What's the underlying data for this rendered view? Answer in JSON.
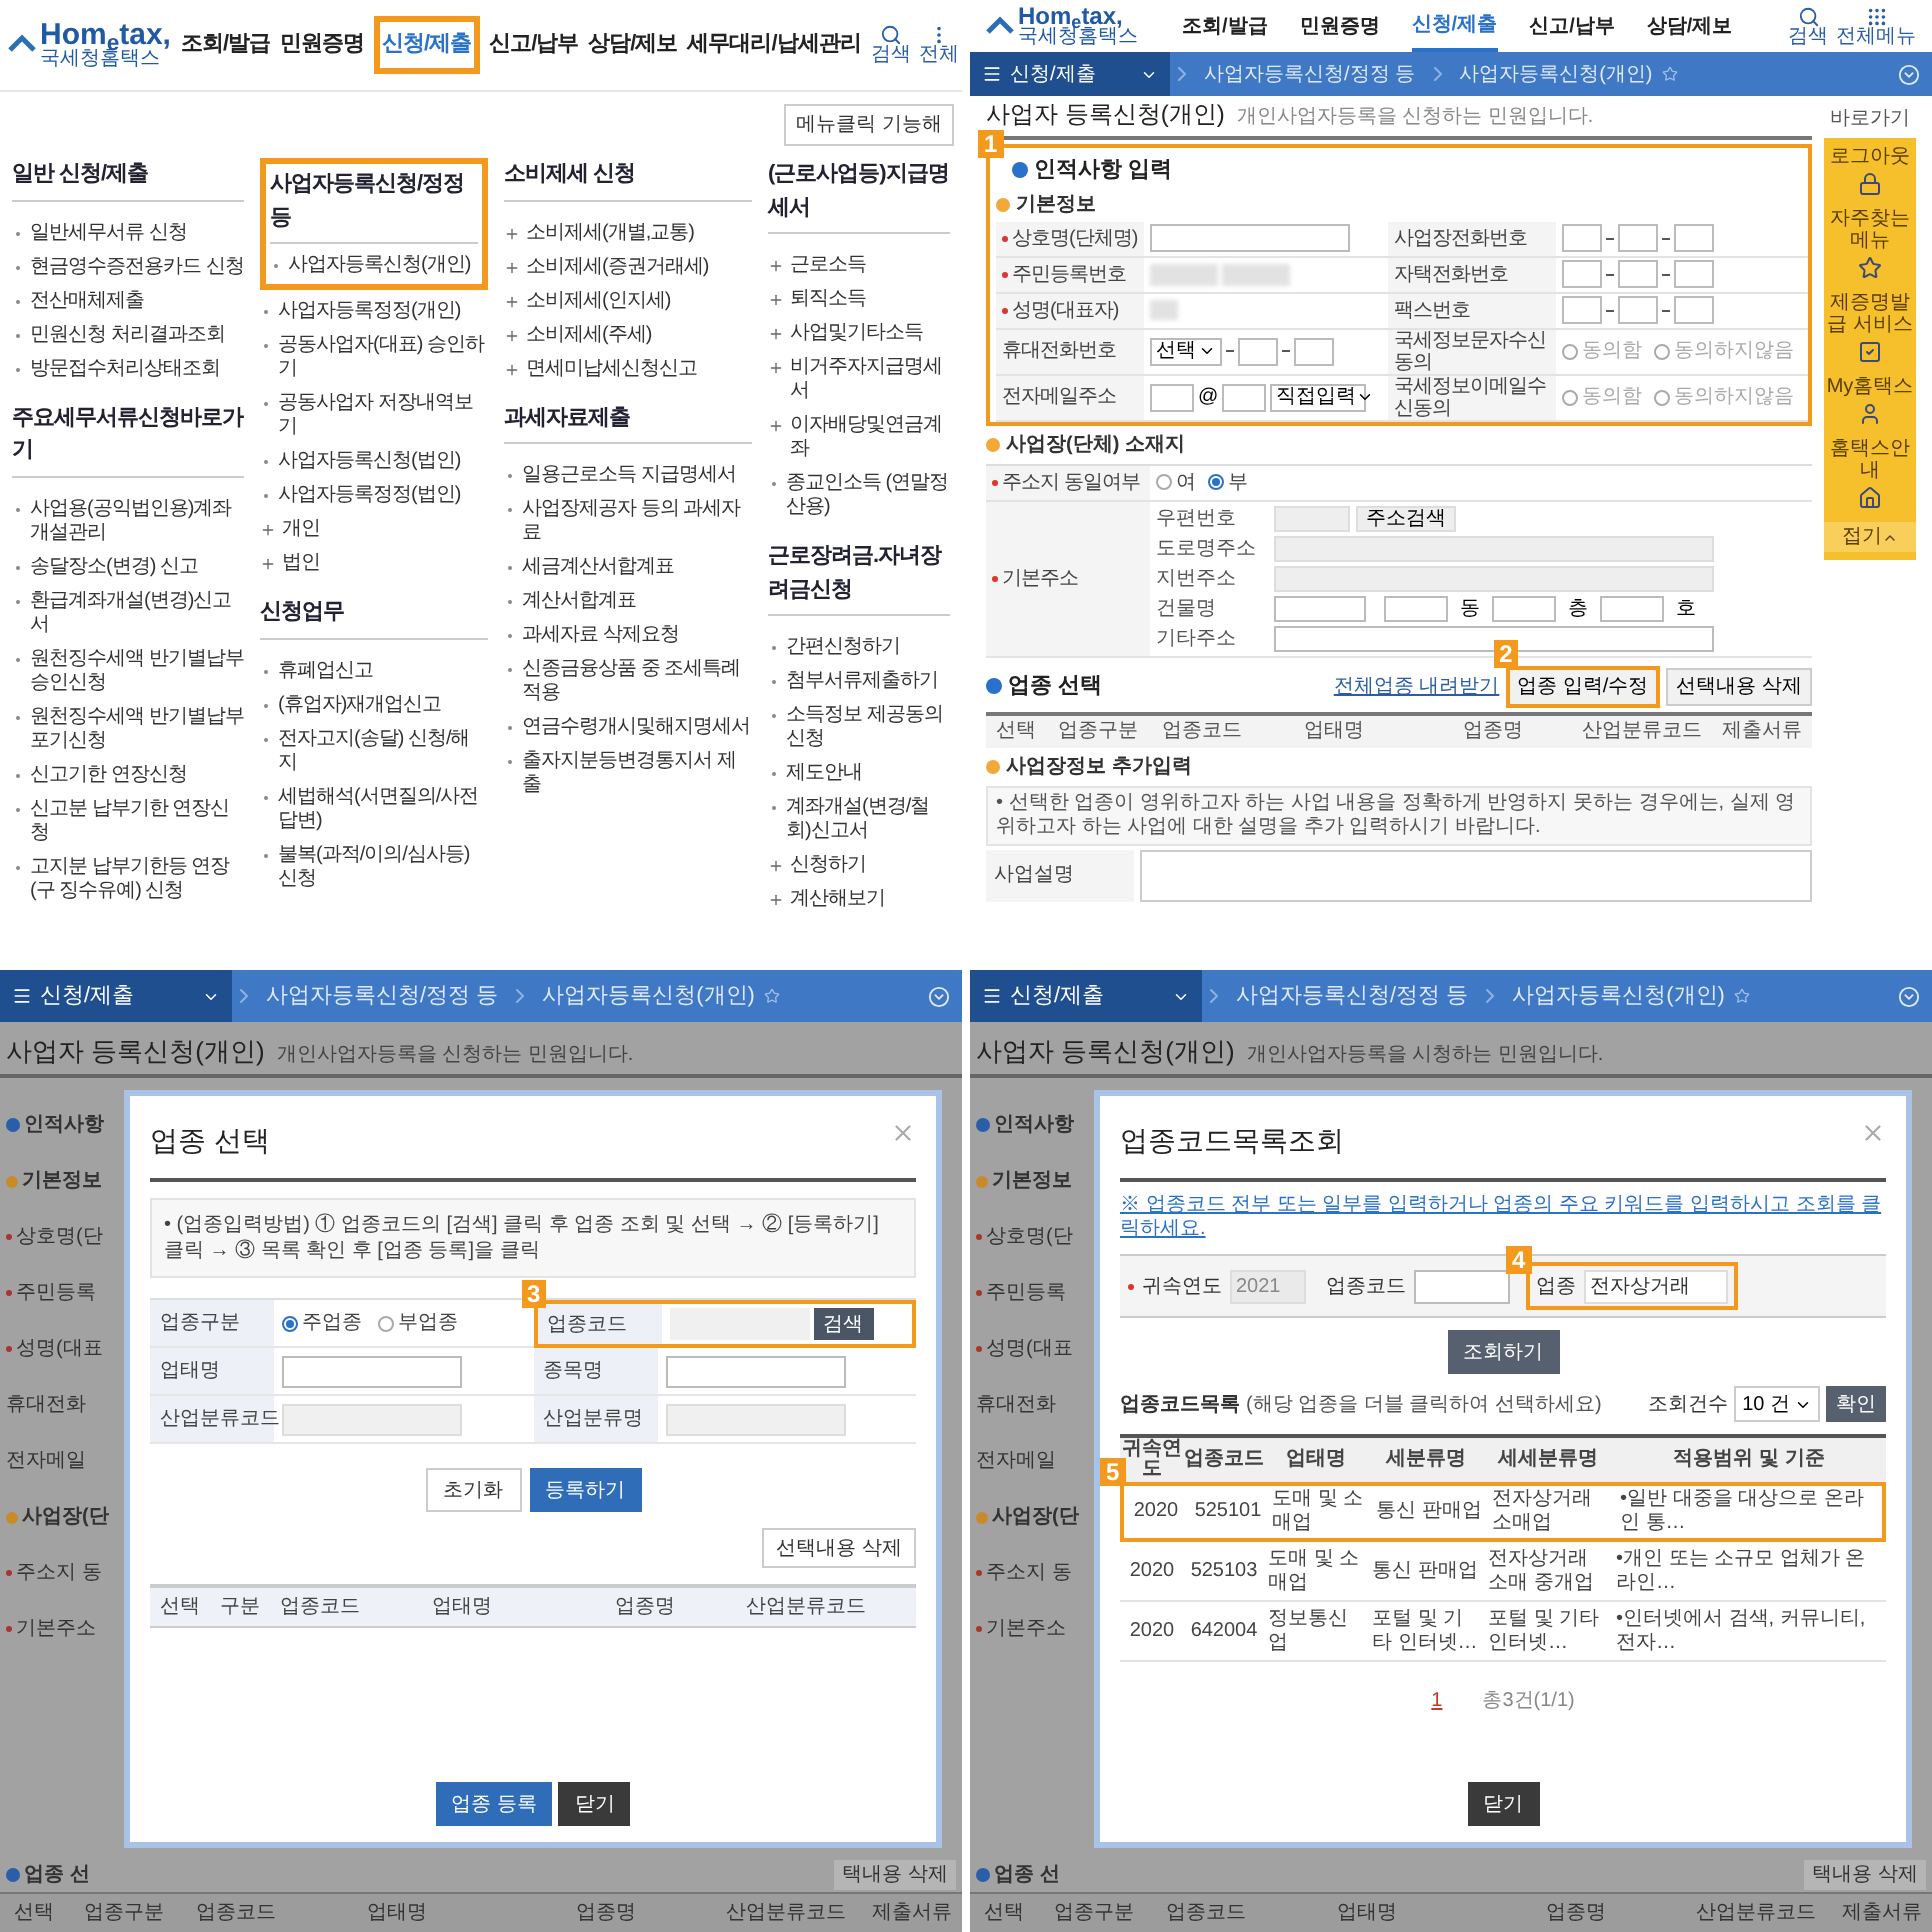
{
  "menu_screen": {
    "logo": {
      "name": "Hom$_{e}$tax,",
      "subtitle": "국세청홈택스"
    },
    "nav": [
      {
        "label": "조회/발급",
        "selected": false
      },
      {
        "label": "민원증명",
        "selected": false
      },
      {
        "label": "신청/제출",
        "selected": true
      },
      {
        "label": "신고/납부",
        "selected": false
      },
      {
        "label": "상담/제보",
        "selected": false
      },
      {
        "label": "세무대리/납세관리",
        "selected": false
      }
    ],
    "utilities": [
      {
        "kind": "search",
        "label": "검색"
      },
      {
        "kind": "more",
        "label": "전체"
      }
    ],
    "menu_toggle": "메뉴클릭 기능해",
    "columns": [
      [
        {
          "heading": "일반 신청/제출",
          "highlighted": false,
          "items": [
            {
              "label": "일반세무서류 신청",
              "kind": "bullet"
            },
            {
              "label": "현금영수증전용카드 신청",
              "kind": "bullet"
            },
            {
              "label": "전산매체제출",
              "kind": "bullet"
            },
            {
              "label": "민원신청 처리결과조회",
              "kind": "bullet"
            },
            {
              "label": "방문접수처리상태조회",
              "kind": "bullet"
            }
          ]
        },
        {
          "heading": "주요세무서류신청바로가기",
          "highlighted": false,
          "items": [
            {
              "label": "사업용(공익법인용)계좌 개설관리",
              "kind": "bullet"
            },
            {
              "label": "송달장소(변경) 신고",
              "kind": "bullet"
            },
            {
              "label": "환급계좌개설(변경)신고서",
              "kind": "bullet"
            },
            {
              "label": "원천징수세액 반기별납부 승인신청",
              "kind": "bullet"
            },
            {
              "label": "원천징수세액 반기별납부 포기신청",
              "kind": "bullet"
            },
            {
              "label": "신고기한 연장신청",
              "kind": "bullet"
            },
            {
              "label": "신고분 납부기한 연장신청",
              "kind": "bullet"
            },
            {
              "label": "고지분 납부기한등 연장(구 징수유예) 신청",
              "kind": "bullet"
            }
          ]
        }
      ],
      [
        {
          "heading": "사업자등록신청/정정 등",
          "highlighted": true,
          "items": [
            {
              "label": "사업자등록신청(개인)",
              "kind": "bullet"
            },
            {
              "label": "사업자등록정정(개인)",
              "kind": "bullet"
            },
            {
              "label": "공동사업자(대표) 승인하기",
              "kind": "bullet"
            },
            {
              "label": "공동사업자 저장내역보기",
              "kind": "bullet"
            },
            {
              "label": "사업자등록신청(법인)",
              "kind": "bullet"
            },
            {
              "label": "사업자등록정정(법인)",
              "kind": "bullet"
            },
            {
              "label": "개인",
              "kind": "plus"
            },
            {
              "label": "법인",
              "kind": "plus"
            }
          ]
        },
        {
          "heading": "신청업무",
          "highlighted": false,
          "items": [
            {
              "label": "휴폐업신고",
              "kind": "bullet"
            },
            {
              "label": "(휴업자)재개업신고",
              "kind": "bullet"
            },
            {
              "label": "전자고지(송달) 신청/해지",
              "kind": "bullet"
            },
            {
              "label": "세법해석(서면질의/사전답변)",
              "kind": "bullet"
            },
            {
              "label": "불복(과적/이의/심사등)신청",
              "kind": "bullet"
            }
          ]
        }
      ],
      [
        {
          "heading": "소비제세 신청",
          "highlighted": false,
          "items": [
            {
              "label": "소비제세(개별,교통)",
              "kind": "plus"
            },
            {
              "label": "소비제세(증권거래세)",
              "kind": "plus"
            },
            {
              "label": "소비제세(인지세)",
              "kind": "plus"
            },
            {
              "label": "소비제세(주세)",
              "kind": "plus"
            },
            {
              "label": "면세미납세신청신고",
              "kind": "plus"
            }
          ]
        },
        {
          "heading": "과세자료제출",
          "highlighted": false,
          "items": [
            {
              "label": "일용근로소득 지급명세서",
              "kind": "bullet"
            },
            {
              "label": "사업장제공자 등의 과세자료",
              "kind": "bullet"
            },
            {
              "label": "세금계산서합계표",
              "kind": "bullet"
            },
            {
              "label": "계산서합계표",
              "kind": "bullet"
            },
            {
              "label": "과세자료 삭제요청",
              "kind": "bullet"
            },
            {
              "label": "신종금융상품 중 조세특례적용",
              "kind": "bullet"
            },
            {
              "label": "연금수령개시및해지명세서",
              "kind": "bullet"
            },
            {
              "label": "출자지분등변경통지서 제출",
              "kind": "bullet"
            }
          ]
        }
      ],
      [
        {
          "heading": "(근로사업등)지급명세서",
          "highlighted": false,
          "items": [
            {
              "label": "근로소득",
              "kind": "plus"
            },
            {
              "label": "퇴직소득",
              "kind": "plus"
            },
            {
              "label": "사업및기타소득",
              "kind": "plus"
            },
            {
              "label": "비거주자지급명세서",
              "kind": "plus"
            },
            {
              "label": "이자배당및연금계좌",
              "kind": "plus"
            },
            {
              "label": "종교인소득 (연말정산용)",
              "kind": "bullet"
            }
          ]
        },
        {
          "heading": "근로장려금.자녀장려금신청",
          "highlighted": false,
          "items": [
            {
              "label": "간편신청하기",
              "kind": "bullet"
            },
            {
              "label": "첨부서류제출하기",
              "kind": "bullet"
            },
            {
              "label": "소득정보 제공동의 신청",
              "kind": "bullet"
            },
            {
              "label": "제도안내",
              "kind": "bullet"
            },
            {
              "label": "계좌개설(변경/철회)신고서",
              "kind": "bullet"
            },
            {
              "label": "신청하기",
              "kind": "plus"
            },
            {
              "label": "계산해보기",
              "kind": "plus"
            }
          ]
        }
      ]
    ]
  },
  "form_screen": {
    "logo": {
      "name": "Hom$_{e}$tax,",
      "subtitle": "국세청홈택스"
    },
    "nav": [
      {
        "label": "조회/발급",
        "selected": false
      },
      {
        "label": "민원증명",
        "selected": false
      },
      {
        "label": "신청/제출",
        "selected": true
      },
      {
        "label": "신고/납부",
        "selected": false
      },
      {
        "label": "상담/제보",
        "selected": false
      }
    ],
    "utilities": [
      {
        "kind": "search",
        "label": "검색"
      },
      {
        "kind": "grid",
        "label": "전체메뉴"
      }
    ],
    "breadcrumb": {
      "menu": "신청/제출",
      "items": [
        "사업자등록신청/정정 등",
        "사업자등록신청(개인)"
      ]
    },
    "page_title": "사업자 등록신청(개인)",
    "page_description": "개인사업자등록을 신청하는 민원입니다.",
    "personal": {
      "step": "1",
      "heading": "인적사항 입력",
      "subheading": "기본정보",
      "rows": [
        {
          "left": {
            "label": "상호명(단체명)",
            "required": true,
            "kind": "text"
          },
          "right": {
            "label": "사업장전화번호",
            "kind": "phone"
          }
        },
        {
          "left": {
            "label": "주민등록번호",
            "required": true,
            "kind": "masked"
          },
          "right": {
            "label": "자택전화번호",
            "kind": "phone"
          }
        },
        {
          "left": {
            "label": "성명(대표자)",
            "required": true,
            "kind": "masked_short"
          },
          "right": {
            "label": "팩스번호",
            "kind": "phone"
          }
        },
        {
          "left": {
            "label": "휴대전화번호",
            "required": false,
            "kind": "phone_select",
            "select": "선택"
          },
          "right": {
            "label": "국세정보문자수신동의",
            "kind": "radio",
            "options": [
              {
                "label": "동의함",
                "selected": false
              },
              {
                "label": "동의하지않음",
                "selected": false
              }
            ]
          }
        },
        {
          "left": {
            "label": "전자메일주소",
            "required": false,
            "kind": "email",
            "at": "@",
            "select": "직접입력"
          },
          "right": {
            "label": "국세정보이메일수신동의",
            "kind": "radio",
            "options": [
              {
                "label": "동의함",
                "selected": false
              },
              {
                "label": "동의하지않음",
                "selected": false
              }
            ]
          }
        }
      ]
    },
    "address": {
      "heading": "사업장(단체) 소재지",
      "same_address": {
        "label": "주소지 동일여부",
        "required": true,
        "options": [
          {
            "label": "여",
            "selected": false
          },
          {
            "label": "부",
            "selected": true
          }
        ]
      },
      "base_address": {
        "label": "기본주소",
        "required": true,
        "fields": [
          {
            "label": "우편번호",
            "kind": "zip",
            "button": "주소검색"
          },
          {
            "label": "도로명주소",
            "kind": "readonly"
          },
          {
            "label": "지번주소",
            "kind": "readonly"
          },
          {
            "label": "건물명",
            "kind": "building",
            "units": [
              "동",
              "층",
              "호"
            ]
          },
          {
            "label": "기타주소",
            "kind": "text"
          }
        ]
      }
    },
    "industry": {
      "step": "2",
      "heading": "업종 선택",
      "download_link": "전체업종 내려받기",
      "buttons": [
        {
          "label": "업종 입력/수정",
          "highlighted": true
        },
        {
          "label": "선택내용 삭제",
          "highlighted": false
        }
      ],
      "columns": [
        "선택",
        "업종구분",
        "업종코드",
        "업태명",
        "업종명",
        "산업분류코드",
        "제출서류"
      ]
    },
    "extra": {
      "heading": "사업장정보 추가입력",
      "note": "• 선택한 업종이 영위하고자 하는 사업 내용을 정확하게 반영하지 못하는 경우에는, 실제 영위하고자 하는 사업에 대한 설명을 추가 입력하시기 바랍니다.",
      "field_label": "사업설명"
    },
    "quick_bar": {
      "title": "바로가기",
      "items": [
        {
          "label": "로그아웃",
          "kind": "lock"
        },
        {
          "label": "자주찾는 메뉴",
          "kind": "star"
        },
        {
          "label": "제증명발급 서비스",
          "kind": "check"
        },
        {
          "label": "My홈택스",
          "kind": "user"
        },
        {
          "label": "홈택스안내",
          "kind": "home"
        }
      ],
      "collapse": "접기"
    }
  },
  "select_modal_screen": {
    "background": {
      "breadcrumb": {
        "menu": "신청/제출",
        "items": [
          "사업자등록신청/정정 등",
          "사업자등록신청(개인)"
        ]
      },
      "page_title": "사업자 등록신청(개인)",
      "page_description": "개인사업자등록을 신청하는 민원입니다.",
      "side_labels": [
        {
          "text": "인적사항",
          "kind": "section",
          "required": false
        },
        {
          "text": "기본정보",
          "kind": "sub",
          "required": false
        },
        {
          "text": "상호명(단",
          "kind": "label",
          "required": true
        },
        {
          "text": "주민등록",
          "kind": "label",
          "required": true
        },
        {
          "text": "성명(대표",
          "kind": "label",
          "required": true
        },
        {
          "text": "휴대전화",
          "kind": "label",
          "required": false
        },
        {
          "text": "전자메일",
          "kind": "label",
          "required": false
        },
        {
          "text": "사업장(단",
          "kind": "sub",
          "required": false
        },
        {
          "text": "주소지 동",
          "kind": "label",
          "required": true
        },
        {
          "text": "기본주소",
          "kind": "label",
          "required": true
        }
      ],
      "bottom_fragments": [
        {
          "text": "업종 선",
          "kind": "section"
        },
        {
          "text": "택내용 삭제",
          "kind": "button"
        }
      ],
      "columns": [
        "선택",
        "업종구분",
        "업종코드",
        "업태명",
        "업종명",
        "산업분류코드",
        "제출서류"
      ]
    },
    "modal": {
      "title": "업종 선택",
      "instruction": "• (업종입력방법) ① 업종코드의 [검색] 클릭 후 업종 조회 및 선택 → ② [등록하기] 클릭 → ③ 목록 확인 후 [업종 등록]을 클릭",
      "fields": [
        {
          "label": "업종구분",
          "kind": "radio",
          "options": [
            {
              "label": "주업종",
              "selected": true
            },
            {
              "label": "부업종",
              "selected": false
            }
          ]
        },
        {
          "label": "업종코드",
          "kind": "search",
          "button": "검색",
          "step": "3"
        },
        {
          "label": "업태명",
          "kind": "text"
        },
        {
          "label": "종목명",
          "kind": "text"
        },
        {
          "label": "산업분류코드",
          "kind": "readonly"
        },
        {
          "label": "산업분류명",
          "kind": "readonly"
        }
      ],
      "buttons": [
        {
          "label": "초기화",
          "kind": "secondary"
        },
        {
          "label": "등록하기",
          "kind": "primary"
        }
      ],
      "delete_button": "선택내용 삭제",
      "columns": [
        "선택",
        "구분",
        "업종코드",
        "업태명",
        "업종명",
        "산업분류코드"
      ],
      "footer_buttons": [
        {
          "label": "업종 등록",
          "kind": "primary"
        },
        {
          "label": "닫기",
          "kind": "dark"
        }
      ]
    }
  },
  "code_list_screen": {
    "background": {
      "breadcrumb": {
        "menu": "신청/제출",
        "items": [
          "사업자등록신청/정정 등",
          "사업자등록신청(개인)"
        ]
      },
      "page_title": "사업자 등록신청(개인)",
      "page_description": "개인사업자등록을 시청하는 민원입니다.",
      "side_labels": [
        {
          "text": "인적사항",
          "kind": "section",
          "required": false
        },
        {
          "text": "기본정보",
          "kind": "sub",
          "required": false
        },
        {
          "text": "상호명(단",
          "kind": "label",
          "required": true
        },
        {
          "text": "주민등록",
          "kind": "label",
          "required": true
        },
        {
          "text": "성명(대표",
          "kind": "label",
          "required": true
        },
        {
          "text": "휴대전화",
          "kind": "label",
          "required": false
        },
        {
          "text": "전자메일",
          "kind": "label",
          "required": false
        },
        {
          "text": "사업장(단",
          "kind": "sub",
          "required": false
        },
        {
          "text": "주소지 동",
          "kind": "label",
          "required": true
        },
        {
          "text": "기본주소",
          "kind": "label",
          "required": true
        }
      ],
      "bottom_fragments": [
        {
          "text": "업종 선",
          "kind": "section"
        },
        {
          "text": "택내용 삭제",
          "kind": "button"
        }
      ],
      "columns": [
        "선택",
        "업종구분",
        "업종코드",
        "업태명",
        "업종명",
        "산업분류코드",
        "제출서류"
      ]
    },
    "modal": {
      "title": "업종코드목록조회",
      "hint": "※ 업종코드 전부 또는 일부를 입력하거나 업종의 주요 키워드를 입력하시고 조회를 클릭하세요.",
      "search": {
        "year_label": "귀속연도",
        "year_value": "2021",
        "code_label": "업종코드",
        "industry_label": "업종",
        "industry_value": "전자상거래",
        "step": "4"
      },
      "search_button": "조회하기",
      "list_title": "업종코드목록",
      "list_hint": "(해당 업종을 더블 클릭하여 선택하세요)",
      "page_size": {
        "label": "조회건수",
        "value": "10 건",
        "button": "확인"
      },
      "table": {
        "step": "5",
        "columns": [
          "귀속연도",
          "업종코드",
          "업태명",
          "세분류명",
          "세세분류명",
          "적용범위 및 기준"
        ],
        "rows": [
          {
            "cells": [
              "2020",
              "525101",
              "도매 및 소매업",
              "통신 판매업",
              "전자상거래 소매업",
              "•일반 대중을 대상으로 온라인 통…"
            ],
            "selected": true
          },
          {
            "cells": [
              "2020",
              "525103",
              "도매 및 소매업",
              "통신 판매업",
              "전자상거래 소매 중개업",
              "•개인 또는 소규모 업체가 온라인…"
            ],
            "selected": false
          },
          {
            "cells": [
              "2020",
              "642004",
              "정보통신업",
              "포털 및 기타 인터넷…",
              "포털 및 기타 인터넷…",
              "•인터넷에서 검색, 커뮤니티, 전자…"
            ],
            "selected": false
          }
        ]
      },
      "pagination": {
        "page": "1",
        "total": "총3건(1/1)"
      },
      "close_button": "닫기"
    }
  }
}
